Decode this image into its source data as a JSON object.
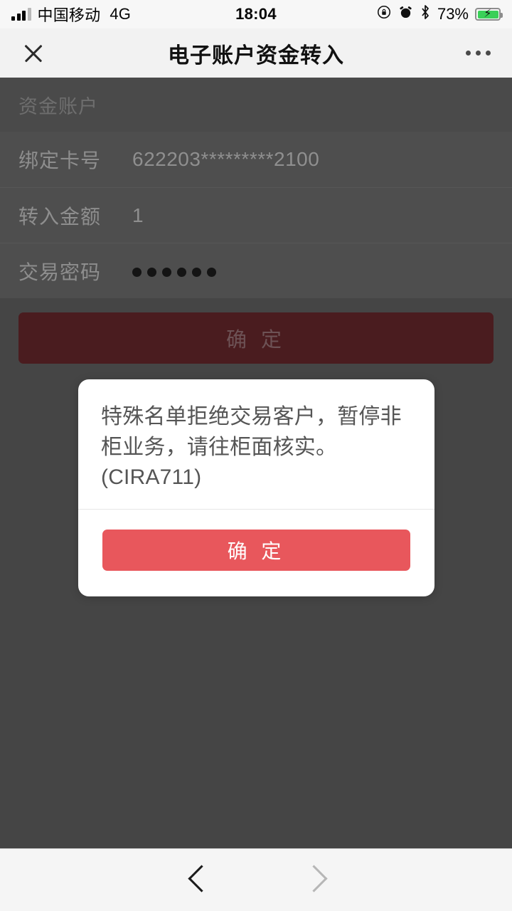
{
  "status_bar": {
    "carrier": "中国移动",
    "network": "4G",
    "time": "18:04",
    "battery_percent": "73%",
    "icons": [
      "signal-bars-icon",
      "rotation-lock-icon",
      "alarm-clock-icon",
      "bluetooth-icon",
      "battery-charging-icon"
    ]
  },
  "nav_bar": {
    "close_icon": "close-icon",
    "title": "电子账户资金转入",
    "more_icon": "more-options-icon"
  },
  "page": {
    "section_header": "资金账户",
    "rows": [
      {
        "label": "绑定卡号",
        "value": "622203*********2100",
        "type": "text"
      },
      {
        "label": "转入金额",
        "value": "1",
        "type": "text"
      },
      {
        "label": "交易密码",
        "value": "••••••",
        "type": "password",
        "mask_count": 6
      }
    ],
    "submit_label": "确 定"
  },
  "dialog": {
    "message": "特殊名单拒绝交易客户，暂停非柜业务，请往柜面核实。(CIRA711)",
    "confirm_label": "确 定",
    "button_color": "#e8575c"
  },
  "bottom_bar": {
    "back_icon": "chevron-left-icon",
    "forward_icon": "chevron-right-icon"
  },
  "colors": {
    "accent_red": "#e8575c",
    "dimmed_overlay": "#454545",
    "form_background": "#4e4e4e"
  }
}
